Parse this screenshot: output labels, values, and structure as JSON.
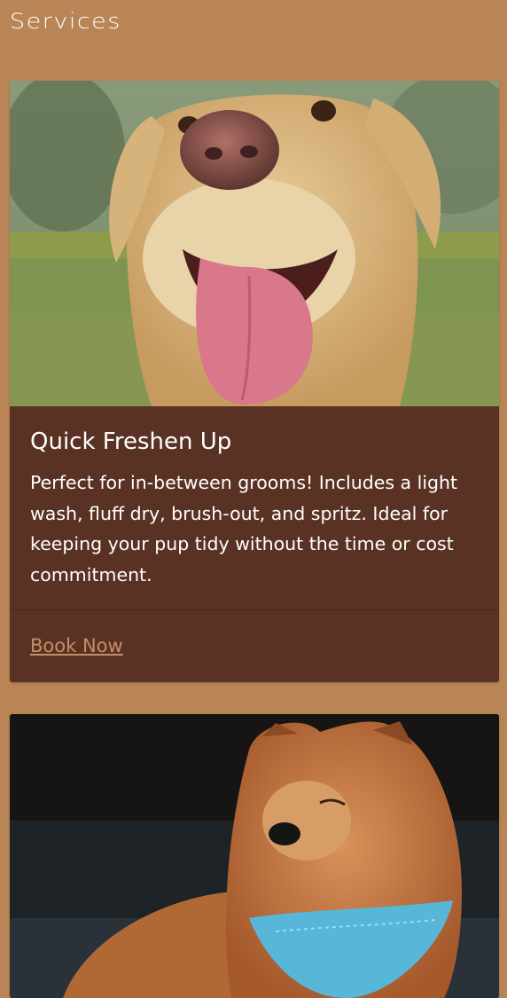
{
  "page": {
    "title": "Services",
    "background": "#b98557"
  },
  "services": [
    {
      "image": "labrador-dog-photo",
      "title": "Quick Freshen Up",
      "description": "Perfect for in-between grooms! Includes a light wash, fluff dry, brush-out, and spritz. Ideal for keeping your pup tidy without the time or cost commitment.",
      "action_label": "Book Now"
    },
    {
      "image": "chow-chow-dog-photo"
    }
  ],
  "colors": {
    "card_bg": "#5a3224",
    "link": "#c39067",
    "text": "#ffffff"
  }
}
